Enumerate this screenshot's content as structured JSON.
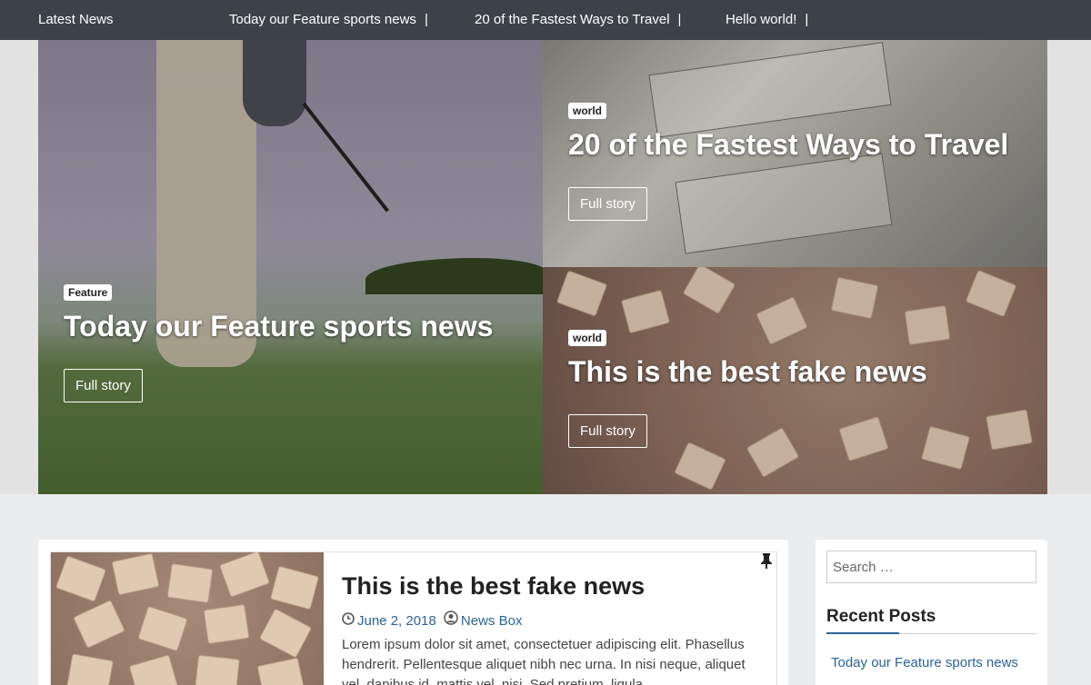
{
  "ticker": {
    "label": "Latest News",
    "items": [
      "Today our Feature sports news",
      "20 of the Fastest Ways to Travel",
      "Hello world!"
    ],
    "separator": "|"
  },
  "hero": {
    "main": {
      "category": "Feature",
      "title": "Today our Feature sports news",
      "button": "Full story"
    },
    "top_right": {
      "category": "world",
      "title": "20 of the Fastest Ways to Travel",
      "button": "Full story"
    },
    "bottom_right": {
      "category": "world",
      "title": "This is the best fake news",
      "button": "Full story"
    }
  },
  "post": {
    "title": "This is the best fake news",
    "date": "June 2, 2018",
    "author": "News Box",
    "excerpt": "Lorem ipsum dolor sit amet, consectetuer adipiscing elit. Phasellus hendrerit. Pellentesque aliquet nibh nec urna. In nisi neque, aliquet vel, dapibus id, mattis vel, nisi. Sed pretium, ligula"
  },
  "sidebar": {
    "search_placeholder": "Search …",
    "recent_title": "Recent Posts",
    "recent_posts": [
      "Today our Feature sports news"
    ]
  },
  "colors": {
    "ticker_bg": "#3d4248",
    "link": "#2a6496",
    "page_bg": "#eaecee"
  },
  "icons": {
    "date": "clock-icon",
    "author": "user-circle-icon",
    "sticky": "pushpin-icon"
  }
}
